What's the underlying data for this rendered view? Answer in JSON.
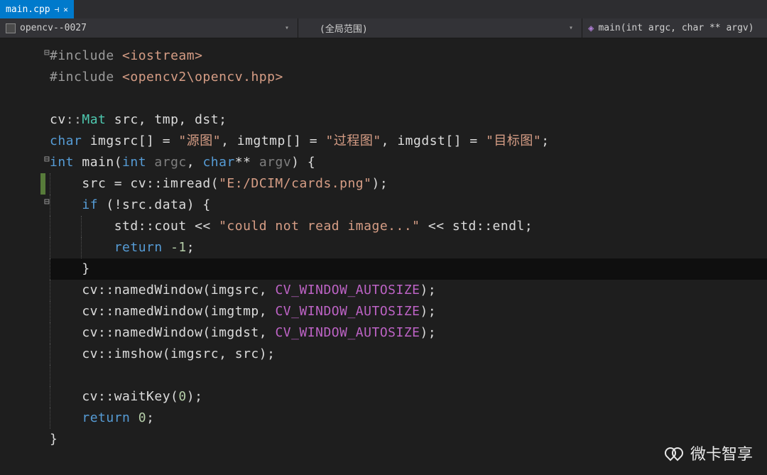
{
  "tab": {
    "filename": "main.cpp"
  },
  "nav": {
    "project": "opencv--0027",
    "scope": "(全局范围)",
    "function": "main(int argc, char ** argv)"
  },
  "code": {
    "l1a": "#include ",
    "l1b": "<iostream>",
    "l2a": "#include ",
    "l2b": "<opencv2\\opencv.hpp>",
    "l4_cv": "cv",
    "l4_mat": "Mat",
    "l4_rest": " src, tmp, dst;",
    "l5_char": "char",
    "l5_a": " imgsrc[] = ",
    "l5_s1": "\"源图\"",
    "l5_b": ", imgtmp[] = ",
    "l5_s2": "\"过程图\"",
    "l5_c": ", imgdst[] = ",
    "l5_s3": "\"目标图\"",
    "l5_d": ";",
    "l6_int": "int",
    "l6_main": " main(",
    "l6_intp": "int",
    "l6_argc": " argc",
    "l6_comma": ", ",
    "l6_char": "char",
    "l6_star": "**",
    "l6_argv": " argv",
    "l6_end": ") {",
    "l7_a": "    src = cv::imread(",
    "l7_s": "\"E:/DCIM/cards.png\"",
    "l7_b": ");",
    "l8_if": "if",
    "l8_rest": " (!src.data) {",
    "l9_a": "        std::cout << ",
    "l9_s": "\"could not read image...\"",
    "l9_b": " << std::endl;",
    "l10_ret": "return",
    "l10_num": " -1",
    "l10_end": ";",
    "l11": "    }",
    "l12_a": "    cv::namedWindow(imgsrc, ",
    "l12_m": "CV_WINDOW_AUTOSIZE",
    "l12_b": ");",
    "l13_a": "    cv::namedWindow(imgtmp, ",
    "l13_m": "CV_WINDOW_AUTOSIZE",
    "l13_b": ");",
    "l14_a": "    cv::namedWindow(imgdst, ",
    "l14_m": "CV_WINDOW_AUTOSIZE",
    "l14_b": ");",
    "l15": "    cv::imshow(imgsrc, src);",
    "l17_a": "    cv::waitKey(",
    "l17_n": "0",
    "l17_b": ");",
    "l18_ret": "return",
    "l18_n": " 0",
    "l18_end": ";",
    "l19": "}"
  },
  "watermark": "微卡智享"
}
